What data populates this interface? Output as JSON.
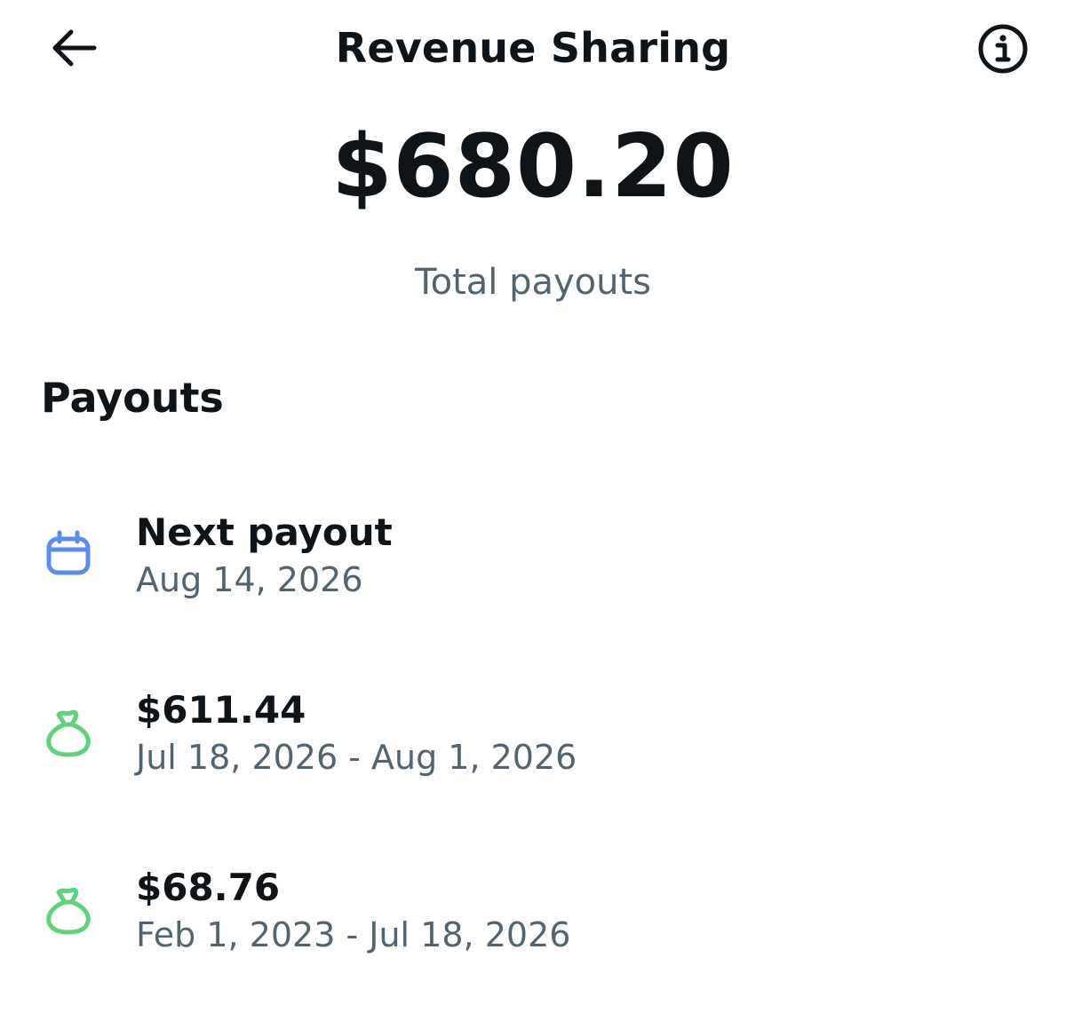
{
  "header": {
    "title": "Revenue Sharing",
    "back_icon": "arrow-left-icon",
    "info_icon": "info-circle-icon"
  },
  "summary": {
    "total_amount": "$680.20",
    "total_label": "Total payouts"
  },
  "payouts": {
    "heading": "Payouts",
    "items": [
      {
        "icon": "calendar-icon",
        "icon_color": "#5b8def",
        "title": "Next payout",
        "subtitle": "Aug 14, 2026"
      },
      {
        "icon": "money-bag-icon",
        "icon_color": "#5fd37a",
        "title": "$611.44",
        "subtitle": "Jul 18, 2026 - Aug 1, 2026"
      },
      {
        "icon": "money-bag-icon",
        "icon_color": "#5fd37a",
        "title": "$68.76",
        "subtitle": "Feb 1, 2023 - Jul 18, 2026"
      }
    ]
  },
  "colors": {
    "text_primary": "#0f1419",
    "text_secondary": "#536471",
    "calendar_blue": "#5b8def",
    "bag_green": "#5fd37a"
  }
}
